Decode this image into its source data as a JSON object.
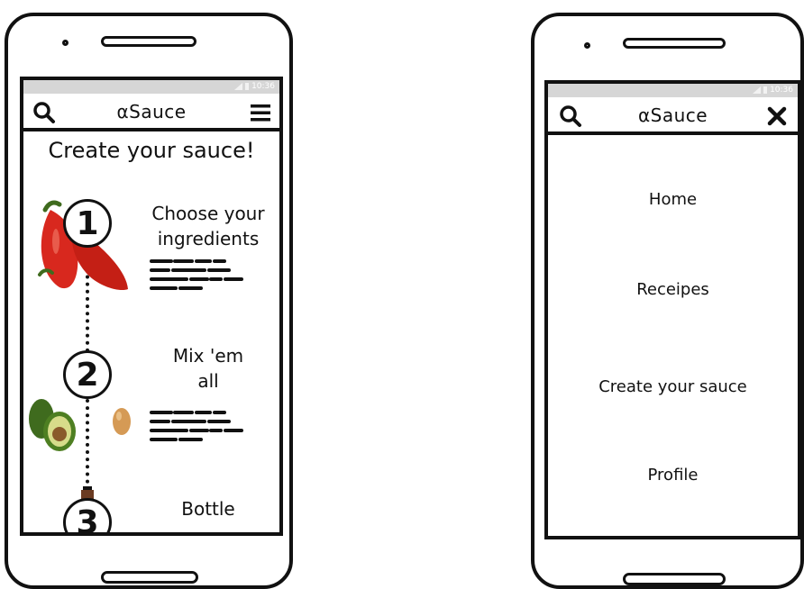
{
  "status_bar": {
    "time": "10:36"
  },
  "left_screen": {
    "app_title": "αSauce",
    "headline": "Create your sauce!",
    "steps": [
      {
        "number": "1",
        "title_line1": "Choose your",
        "title_line2": "ingredients"
      },
      {
        "number": "2",
        "title_line1": "Mix 'em",
        "title_line2": "all"
      },
      {
        "number": "3",
        "title_line1": "Bottle",
        "title_line2": ""
      }
    ]
  },
  "right_screen": {
    "app_title": "αSauce",
    "menu": [
      "Home",
      "Receipes",
      "Create your sauce",
      "Profile"
    ]
  },
  "icons": {
    "left_top_left": "search-icon",
    "left_top_right": "hamburger-menu-icon",
    "right_top_left": "search-icon",
    "right_top_right": "close-icon"
  },
  "colors": {
    "pepper_red": "#d8281e",
    "avocado_green": "#3f6b1e",
    "egg_tan": "#d59a55"
  }
}
